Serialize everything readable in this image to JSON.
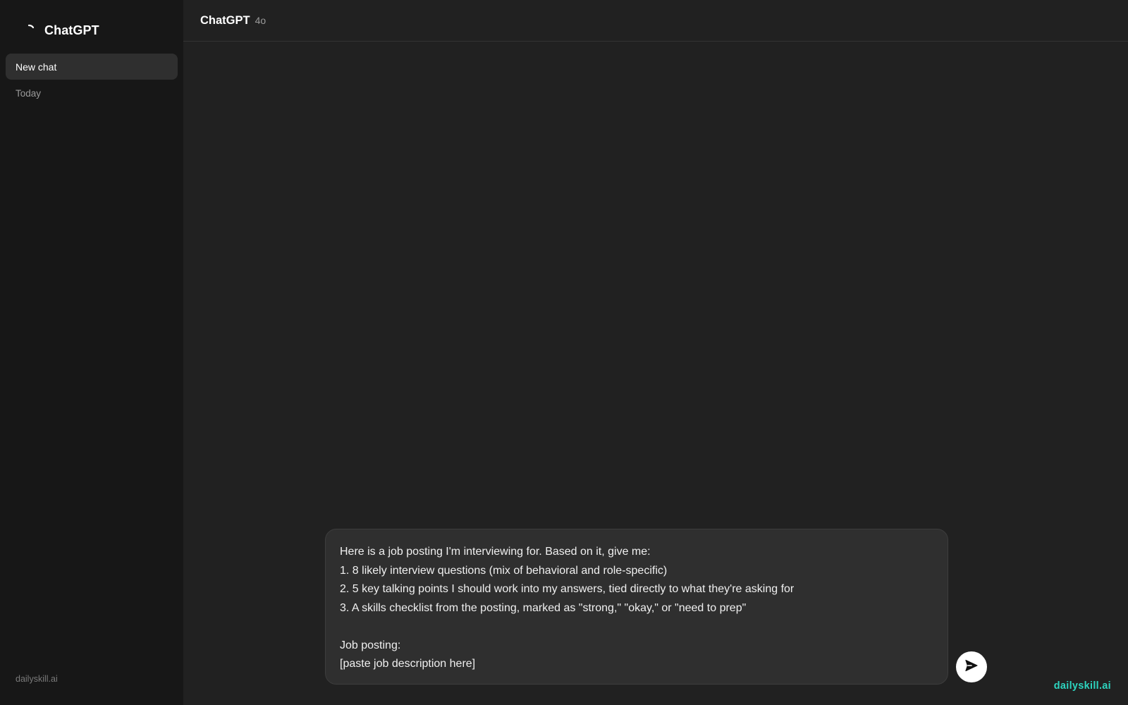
{
  "sidebar": {
    "brand": {
      "name": "ChatGPT",
      "icon": "spinner-icon"
    },
    "new_chat_label": "New chat",
    "section_label": "Today",
    "footer": "dailyskill.ai"
  },
  "header": {
    "title": "ChatGPT",
    "model": "4o"
  },
  "composer": {
    "lines": [
      "Here is a job posting I'm interviewing for. Based on it, give me:",
      "1. 8 likely interview questions (mix of behavioral and role-specific)",
      "2. 5 key talking points I should work into my answers, tied directly to what they're asking for",
      "3. A skills checklist from the posting, marked as \"strong,\" \"okay,\" or \"need to prep\"",
      "",
      "Job posting:",
      "[paste job description here]"
    ],
    "send_icon": "send-arrow-icon"
  },
  "watermark": "dailyskill.ai",
  "colors": {
    "sidebar_bg": "#171717",
    "main_bg": "#212121",
    "composer_bg": "#2f2f2f",
    "accent": "#2dd4bf"
  }
}
